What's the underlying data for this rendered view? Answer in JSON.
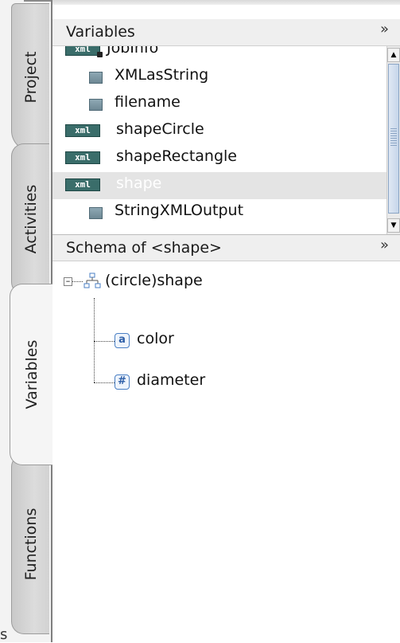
{
  "tabs": [
    {
      "label": "Project",
      "active": false
    },
    {
      "label": "Activities",
      "active": false
    },
    {
      "label": "Variables",
      "active": true
    },
    {
      "label": "Functions",
      "active": false
    }
  ],
  "tabstrip_bottom_text": "s",
  "variables_panel": {
    "title": "Variables",
    "collapse_icon": "double-chevron-down-icon",
    "items": [
      {
        "label": "JobInfo",
        "icon": "xml-locked-icon",
        "indent": 0,
        "selected": false
      },
      {
        "label": "XMLasString",
        "icon": "field-icon",
        "indent": 1,
        "selected": false
      },
      {
        "label": "filename",
        "icon": "field-icon",
        "indent": 1,
        "selected": false
      },
      {
        "label": "shapeCircle",
        "icon": "xml-icon",
        "indent": 0,
        "selected": false
      },
      {
        "label": "shapeRectangle",
        "icon": "xml-icon",
        "indent": 0,
        "selected": false
      },
      {
        "label": "shape",
        "icon": "xml-icon",
        "indent": 0,
        "selected": true
      },
      {
        "label": "StringXMLOutput",
        "icon": "field-icon",
        "indent": 1,
        "selected": false
      }
    ],
    "xml_icon_text": "xml"
  },
  "schema_panel": {
    "title": "Schema of <shape>",
    "collapse_icon": "double-chevron-down-icon",
    "root": {
      "label": "(circle)shape",
      "expander": "⊟"
    },
    "children": [
      {
        "label": "color",
        "icon_text": "a",
        "icon": "attribute-icon"
      },
      {
        "label": "diameter",
        "icon_text": "#",
        "icon": "numeric-element-icon"
      }
    ]
  },
  "colors": {
    "selected_row_bg": "#e4e4e4",
    "xml_icon_bg": "#3a6d6a",
    "scroll_thumb": "#c6d6ea"
  }
}
